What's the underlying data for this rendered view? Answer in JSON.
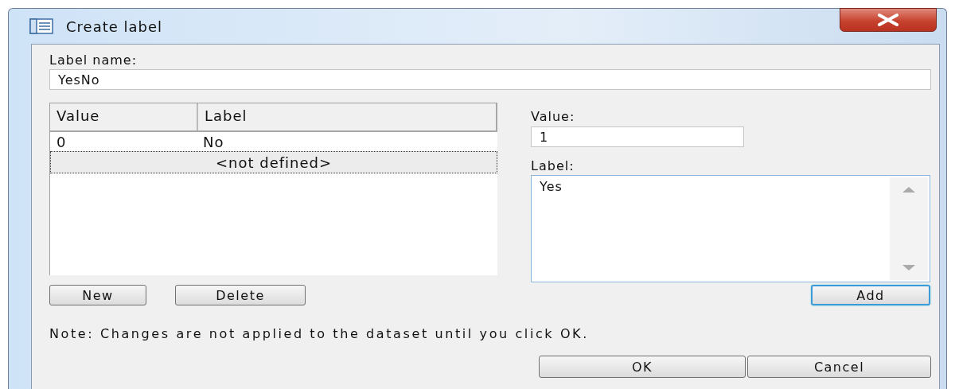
{
  "window": {
    "title": "Create label"
  },
  "label_name": {
    "label": "Label name:",
    "value": "YesNo"
  },
  "table": {
    "columns": [
      "Value",
      "Label"
    ],
    "rows": [
      {
        "kind": "entry",
        "value": "0",
        "label": "No",
        "selected": false
      },
      {
        "kind": "placeholder",
        "text": "<not defined>",
        "selected": true
      }
    ]
  },
  "table_buttons": [
    "New",
    "Delete"
  ],
  "value_field": {
    "label": "Value:",
    "value": "1"
  },
  "label_field": {
    "label": "Label:",
    "value": "Yes"
  },
  "add_button": {
    "label": "Add",
    "default": true
  },
  "note": "Note: Changes are not applied to the dataset until you click OK.",
  "dialog_buttons": [
    "OK",
    "Cancel"
  ]
}
